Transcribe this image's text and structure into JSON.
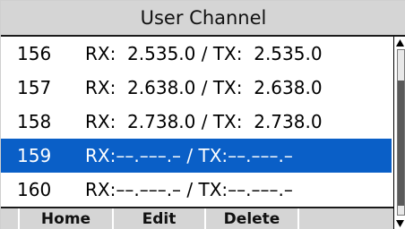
{
  "title": "User Channel",
  "channels": [
    {
      "number": "156",
      "text": "RX:  2.535.0 / TX:  2.535.0"
    },
    {
      "number": "157",
      "text": "RX:  2.638.0 / TX:  2.638.0"
    },
    {
      "number": "158",
      "text": "RX:  2.738.0 / TX:  2.738.0"
    },
    {
      "number": "159",
      "text": "RX:––.–––.– / TX:––.–––.–"
    },
    {
      "number": "160",
      "text": "RX:––.–––.– / TX:––.–––.–"
    }
  ],
  "selected_channel": "159",
  "softkeys": {
    "home": "Home",
    "edit": "Edit",
    "delete": "Delete"
  },
  "colors": {
    "selection": "#0a5fc7",
    "bar": "#d5d5d5"
  },
  "icons": {
    "scroll_up": "triangle-up-icon",
    "scroll_down": "triangle-down-icon"
  }
}
